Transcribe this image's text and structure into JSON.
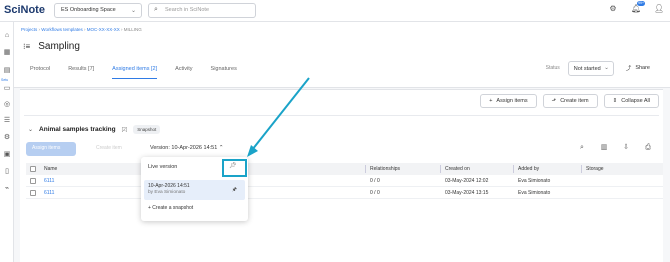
{
  "topbar": {
    "logo": "SciNote",
    "space_selector": "ES Onboarding Space",
    "search_placeholder": "Search in SciNote",
    "notification_count": "99+"
  },
  "leftnav": {
    "active_label": "Setu"
  },
  "breadcrumb": {
    "items": [
      "Projects",
      "Workflows templates",
      "MOC-XX-XX-XX"
    ],
    "current": "MILLING"
  },
  "page": {
    "title": "Sampling"
  },
  "tabs": [
    {
      "label": "Protocol",
      "active": false
    },
    {
      "label": "Results [7]",
      "active": false
    },
    {
      "label": "Assigned items [2]",
      "active": true
    },
    {
      "label": "Activity",
      "active": false
    },
    {
      "label": "Signatures",
      "active": false
    }
  ],
  "status": {
    "label": "Status",
    "value": "Not started"
  },
  "share_label": "Share",
  "card_actions": {
    "assign_items": "Assign items",
    "create_item": "Create item",
    "collapse_all": "Collapse All"
  },
  "assigned_section": {
    "title": "Animal samples tracking",
    "count": "[2]",
    "badge": "Snapshot",
    "assign_button": "Assign items",
    "create_button": "Create item",
    "version_label": "Version: 10-Apr-2026 14:51"
  },
  "table": {
    "columns": [
      "Name",
      "Relationships",
      "Created on",
      "Added by",
      "Storage"
    ],
    "rows": [
      {
        "name": "6111",
        "relationships": "0 / 0",
        "created_on": "03-May-2024 12:02",
        "added_by": "Eva Simionato",
        "storage": ""
      },
      {
        "name": "6111",
        "relationships": "0 / 0",
        "created_on": "03-May-2024 13:15",
        "added_by": "Eva Simionato",
        "storage": ""
      }
    ]
  },
  "version_dropdown": {
    "live_version": "Live version",
    "snapshot_date": "10-Apr-2026 14:51",
    "snapshot_by": "by Eva Simionato",
    "create_snapshot": "+ Create a snapshot"
  },
  "colors": {
    "accent": "#2f7be5",
    "annotation": "#1aa3c8",
    "logo": "#1d3a6e"
  }
}
